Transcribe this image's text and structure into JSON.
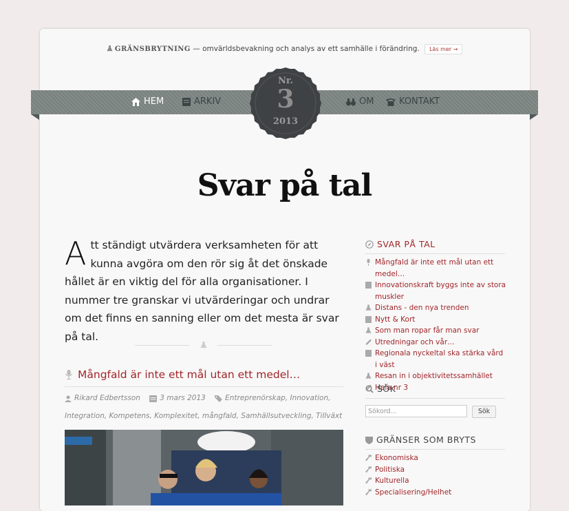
{
  "header": {
    "brand": "GRÄNSBRYTNING",
    "tagline": " — omvärldsbevakning och analys av ett samhälle i förändring.",
    "read_more": "Läs mer →"
  },
  "nav": {
    "items": [
      {
        "label": "HEM",
        "icon": "home-icon"
      },
      {
        "label": "ARKIV",
        "icon": "archive-icon"
      },
      {
        "label": "OM",
        "icon": "binoculars-icon"
      },
      {
        "label": "KONTAKT",
        "icon": "phone-icon"
      }
    ],
    "seal": {
      "top": "Nr.",
      "number": "3",
      "year": "2013"
    }
  },
  "page": {
    "title": "Svar på tal",
    "dropcap": "A",
    "intro": "tt ständigt utvärdera verksamheten för att kunna avgöra om den rör sig åt det önskade hållet är en viktig del för alla organisationer. I nummer tre granskar vi utvärderingar och undrar om det finns en sanning eller om det mesta är svar på tal."
  },
  "post": {
    "title": "Mångfald är inte ett mål utan ett medel…",
    "author": "Rikard Edbertsson",
    "date": "3 mars 2013",
    "tags_line1": "Entreprenörskap, Innovation,",
    "tags_line2": "Integration, Kompetens, Komplexitet, mångfald, Samhällsutveckling, Tillväxt"
  },
  "sidebar": {
    "issue_widget": {
      "title": "SVAR PÅ TAL",
      "items": [
        {
          "label": "Mångfald är inte ett mål utan ett medel…",
          "icon": "microphone-icon"
        },
        {
          "label": "Innovationskraft byggs inte av stora muskler",
          "icon": "document-icon"
        },
        {
          "label": "Distans - den nya trenden",
          "icon": "flask-icon"
        },
        {
          "label": "Nytt & Kort",
          "icon": "document-icon"
        },
        {
          "label": "Som man ropar får man svar",
          "icon": "flask-icon"
        },
        {
          "label": "Utredningar och vår…",
          "icon": "pencil-icon"
        },
        {
          "label": "Regionala nyckeltal ska stärka vård i väst",
          "icon": "document-icon"
        },
        {
          "label": "Resan in i objektivitetssamhället",
          "icon": "flask-icon"
        },
        {
          "label": "Hela nr 3",
          "icon": "pencil-icon"
        }
      ]
    },
    "search_widget": {
      "title": "SÖK",
      "placeholder": "Sökord...",
      "button": "Sök"
    },
    "borders_widget": {
      "title": "GRÄNSER SOM BRYTS",
      "items": [
        {
          "label": "Ekonomiska"
        },
        {
          "label": "Politiska"
        },
        {
          "label": "Kulturella"
        },
        {
          "label": "Specialisering/Helhet"
        }
      ]
    }
  },
  "colors": {
    "accent": "#a0262a",
    "ribbon": "#7e8684",
    "seal": "#444444",
    "background": "#f1ebeb"
  }
}
